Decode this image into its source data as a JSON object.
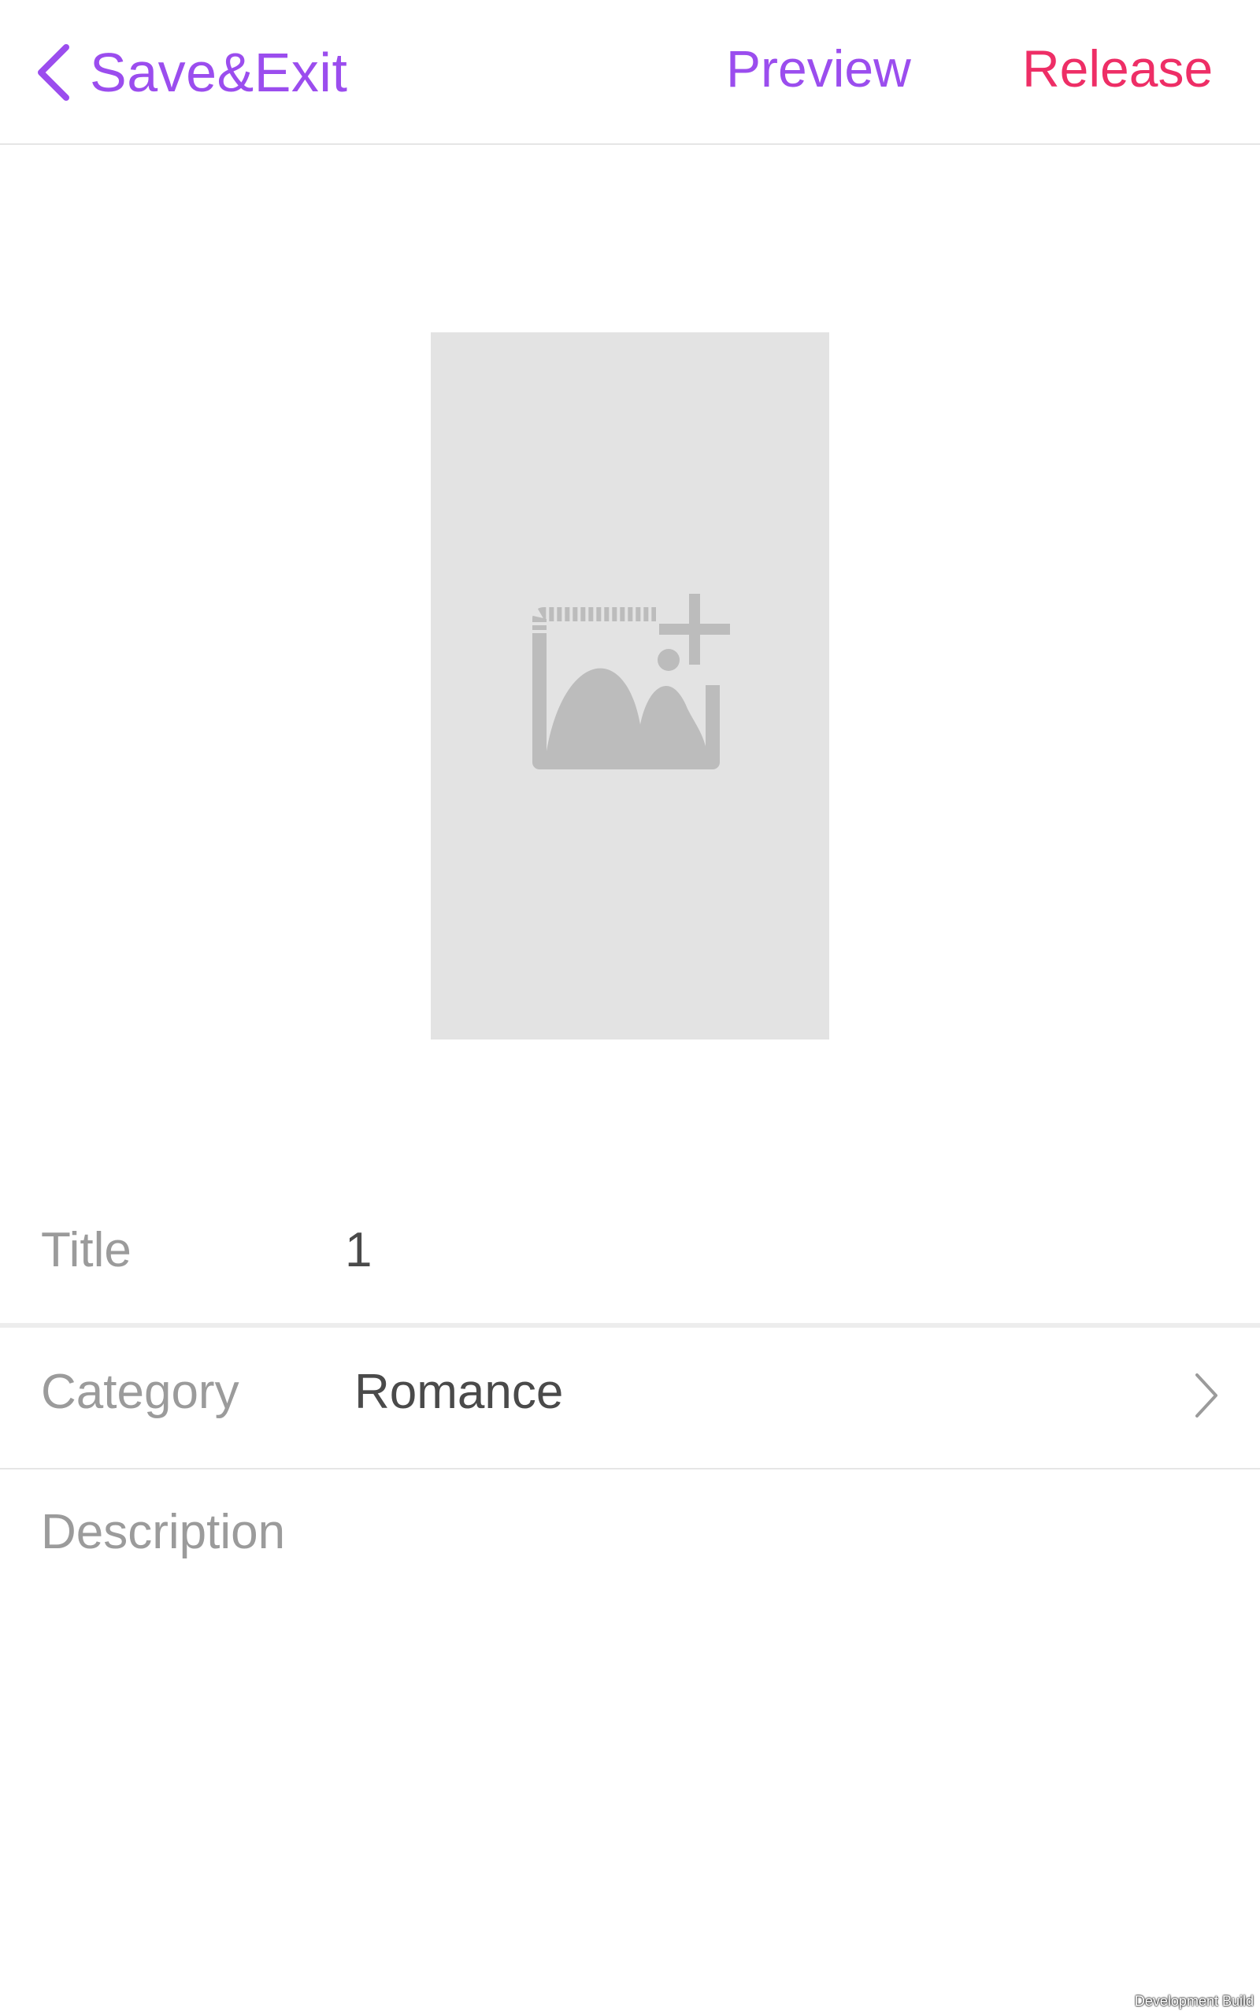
{
  "header": {
    "back_label": "Save&Exit",
    "preview_label": "Preview",
    "release_label": "Release"
  },
  "cover": {
    "icon": "add-image-icon"
  },
  "form": {
    "title_label": "Title",
    "title_value": "1",
    "category_label": "Category",
    "category_value": "Romance",
    "description_label": "Description",
    "description_value": ""
  },
  "footer": {
    "build_label": "Development Build"
  },
  "colors": {
    "accent_purple": "#9b4dee",
    "accent_pink": "#ee2e66",
    "label_gray": "#9b9b9b",
    "value_dark": "#4a4a4a",
    "placeholder_bg": "#e3e3e3"
  }
}
